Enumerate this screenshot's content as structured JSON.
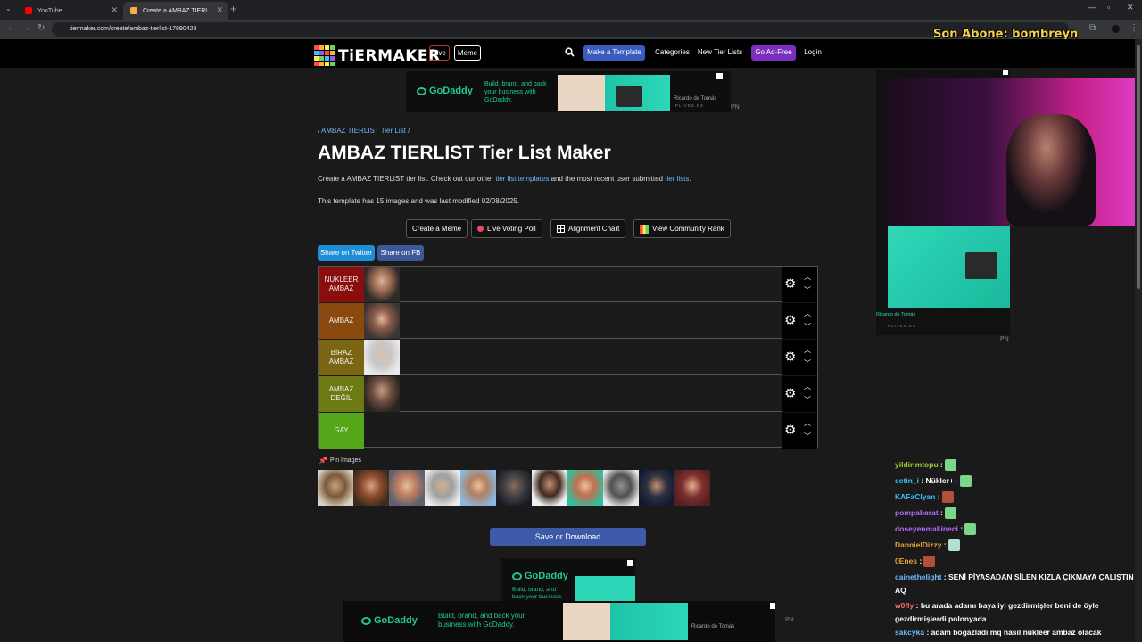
{
  "browser": {
    "tabs": [
      {
        "label": "YouTube",
        "active": false
      },
      {
        "label": "Create a AMBAZ TIERLIST Tier L...",
        "active": true
      }
    ],
    "url": "tiermaker.com/create/ambaz-tierlist-17890428"
  },
  "stream_overlay": {
    "last_subscriber": "Son Abone: bombreyn"
  },
  "header": {
    "logo": "TiERMAKER",
    "live_label": "Live",
    "meme_label": "Meme",
    "make_template_label": "Make a Template",
    "categories_label": "Categories",
    "new_tier_lists_label": "New Tier Lists",
    "ad_free_label": "Go Ad-Free",
    "login_label": "Login",
    "logo_colors": [
      "#ff4a4a",
      "#ffae3b",
      "#ffef4a",
      "#6bd35f",
      "#3fbfff",
      "#8b5cf6",
      "#ff4a4a",
      "#ffae3b",
      "#ffef4a",
      "#6bd35f",
      "#3fbfff",
      "#8b5cf6",
      "#ff4a4a",
      "#ffae3b",
      "#ffef4a",
      "#6bd35f"
    ]
  },
  "ad_top": {
    "brand": "GoDaddy",
    "tagline": "Build, brand, and back your business with GoDaddy.",
    "credit": "Ricardo de Tomás",
    "credit_sub": "PLIVES.ES",
    "marker": "PN"
  },
  "page": {
    "breadcrumb": "/ AMBAZ TIERLIST Tier List /",
    "title": "AMBAZ TIERLIST Tier List Maker",
    "description_prefix": "Create a AMBAZ TIERLIST tier list. Check out our other ",
    "description_link1": "tier list templates",
    "description_mid": " and the most recent user submitted ",
    "description_link2": "tier lists",
    "description_suffix": ".",
    "meta": "This template has 15 images and was last modified 02/08/2025."
  },
  "actions": [
    {
      "label": "Create a Meme"
    },
    {
      "label": "Live Voting Poll"
    },
    {
      "label": "Alignment Chart"
    },
    {
      "label": "View Community Rank"
    }
  ],
  "share": {
    "twitter_label": "Share on Twitter",
    "fb_label": "Share on FB"
  },
  "tiers": [
    {
      "label": "NÜKLEER AMBAZ",
      "color": "#8b0e0e",
      "items": 1
    },
    {
      "label": "AMBAZ",
      "color": "#8a4a0f",
      "items": 1
    },
    {
      "label": "BİRAZ AMBAZ",
      "color": "#7a6612",
      "items": 1
    },
    {
      "label": "AMBAZ DEĞİL",
      "color": "#6d7a14",
      "items": 1
    },
    {
      "label": "GAY",
      "color": "#55a618",
      "items": 0
    }
  ],
  "pin_images_label": "Pin Images",
  "pool_count": 11,
  "save_label": "Save or Download",
  "ad_bottom": {
    "brand": "GoDaddy",
    "tagline": "Build, brand, and back your business with GoDaddy.",
    "tagline_short": "Build, brand, and back your business",
    "credit": "Ricardo de Tomás",
    "marker": "PN"
  },
  "chat": [
    {
      "user": "yildirimtopu",
      "color": "#9acd32",
      "text": " :"
    },
    {
      "user": "cetin_i",
      "color": "#3fbfff",
      "text": " : Nükler++"
    },
    {
      "user": "KAFaCIyan",
      "color": "#3fbfff",
      "text": " :"
    },
    {
      "user": "pompaberat",
      "color": "#b36bff",
      "text": " :"
    },
    {
      "user": "doseyenmakineci",
      "color": "#b36bff",
      "text": " :"
    },
    {
      "user": "DannielDizzy",
      "color": "#e8a33b",
      "text": " :"
    },
    {
      "user": "0Enes",
      "color": "#e8a33b",
      "text": " :"
    },
    {
      "user": "cainethelight",
      "color": "#6fb7ff",
      "text": " : SENİ PİYASADAN SİLEN KIZLA ÇIKMAYA ÇALIŞTIN AQ"
    },
    {
      "user": "w0fly",
      "color": "#ff6b6b",
      "text": " : bu arada adamı baya iyi gezdirmişler beni de öyle gezdirmişlerdi polonyada"
    },
    {
      "user": "sakcyka",
      "color": "#6fb7ff",
      "text": " : adam boğazladı mq nasıl nükleer ambaz olacak"
    }
  ]
}
